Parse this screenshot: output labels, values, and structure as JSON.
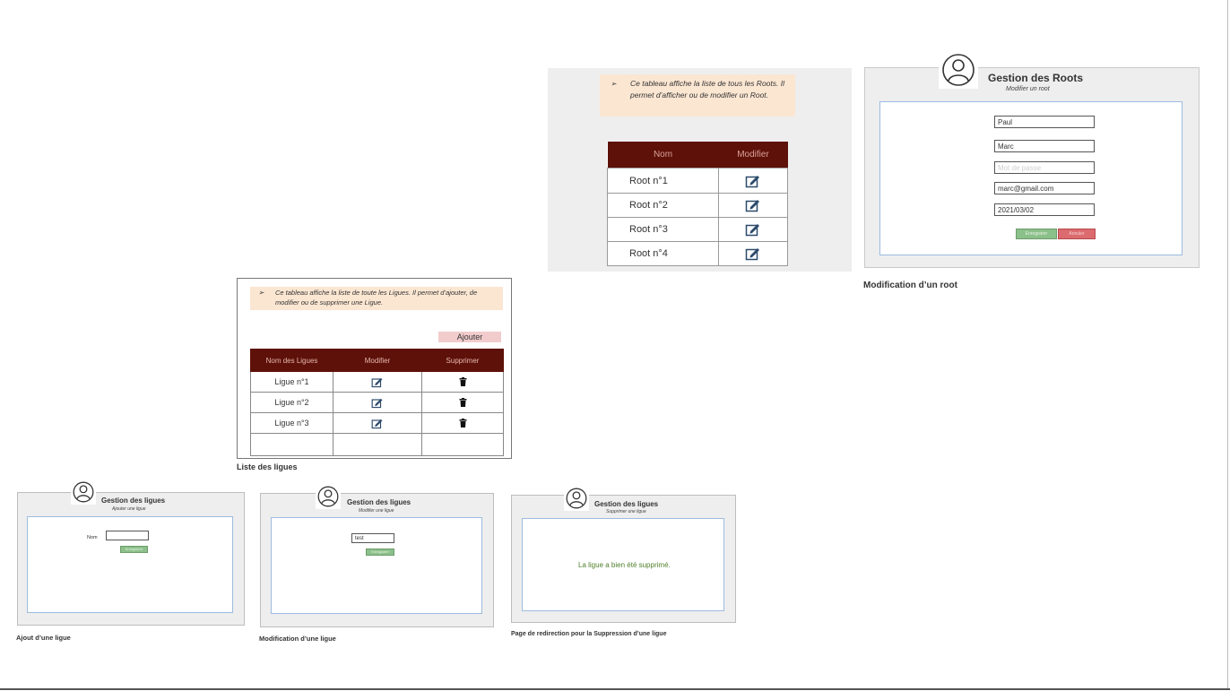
{
  "roots_list": {
    "note": "Ce tableau affiche la liste de tous les Roots. Il permet d’afficher ou de modifier un Root.",
    "arrow": "➢",
    "columns": [
      "Nom",
      "Modifier"
    ],
    "rows": [
      "Root  n°1",
      "Root n°2",
      "Root n°3",
      "Root n°4"
    ]
  },
  "root_edit": {
    "title": "Gestion des Roots",
    "subtitle": "Modifier un root",
    "fields": [
      "Paul",
      "Marc",
      "Mot de passe",
      "marc@gmail.com",
      "2021/03/02"
    ],
    "save_label": "Enregistrer",
    "cancel_label": "Annuler",
    "caption": "Modification d’un root"
  },
  "ligues_list": {
    "note": "Ce tableau affiche la liste de toute les Ligues. Il permet d’ajouter, de modifier ou de supprimer une Ligue.",
    "arrow": "➢",
    "add_label": "Ajouter",
    "columns": [
      "Nom des Ligues",
      "Modifier",
      "Supprimer"
    ],
    "rows": [
      "Ligue n°1",
      "Ligue n°2",
      "Ligue n°3"
    ],
    "caption": "Liste des ligues"
  },
  "add_ligue": {
    "title": "Gestion des ligues",
    "subtitle": "Ajouter une ligue",
    "name_label": "Nom",
    "name_value": "",
    "save_label": "Enregistrer",
    "caption": "Ajout d’une ligue"
  },
  "edit_ligue": {
    "title": "Gestion des ligues",
    "subtitle": "Modifier une ligue",
    "name_value": "test",
    "save_label": "Enregistrer",
    "caption": "Modification d’une ligue"
  },
  "delete_ligue": {
    "title": "Gestion des ligues",
    "subtitle": "Supprimer une ligue",
    "message": "La ligue a bien été supprimé.",
    "caption": "Page de redirection pour la Suppression d’une ligue"
  },
  "colors": {
    "table_header": "#5e1108",
    "note_bg": "#fbe6d2",
    "save_green": "#8cc08a",
    "cancel_red": "#dc6b6f",
    "frame_blue": "#9dbbe0"
  },
  "icons": {
    "edit": "edit-icon",
    "delete": "trash-icon",
    "user": "user-avatar-icon"
  }
}
